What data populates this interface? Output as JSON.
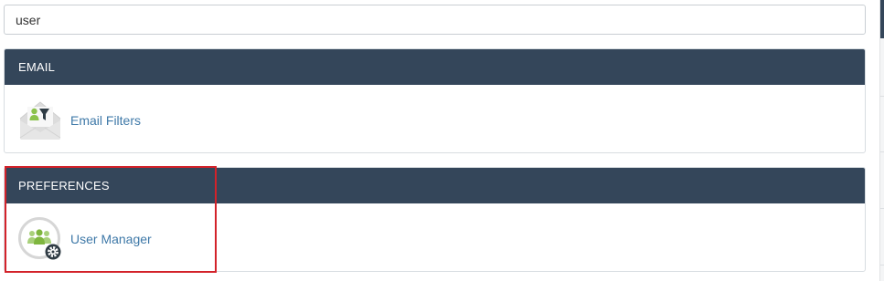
{
  "search": {
    "value": "user"
  },
  "sections": [
    {
      "title": "EMAIL",
      "items": [
        {
          "label": "Email Filters",
          "icon": "email-filters-icon"
        }
      ]
    },
    {
      "title": "PREFERENCES",
      "items": [
        {
          "label": "User Manager",
          "icon": "user-manager-icon"
        }
      ]
    }
  ],
  "colors": {
    "header_bg": "#34465a",
    "link": "#3f79a8",
    "highlight": "#d3222a",
    "accent_green": "#8bc24c"
  }
}
